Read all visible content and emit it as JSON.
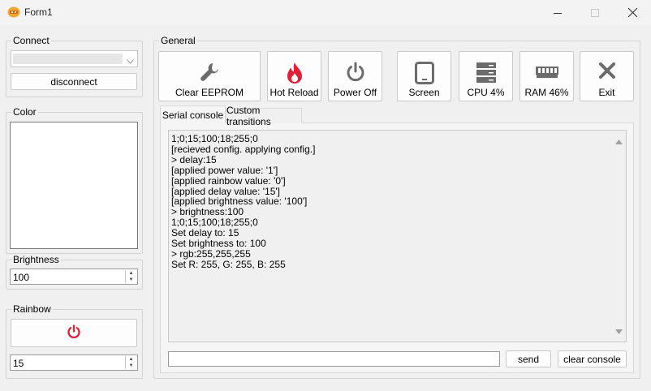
{
  "window": {
    "title": "Form1"
  },
  "connect": {
    "title": "Connect",
    "port_value": "",
    "disconnect_label": "disconnect"
  },
  "color": {
    "title": "Color"
  },
  "brightness": {
    "title": "Brightness",
    "value": "100"
  },
  "rainbow": {
    "title": "Rainbow",
    "delay_value": "15"
  },
  "general": {
    "title": "General",
    "buttons": [
      {
        "label": "Clear EEPROM",
        "icon": "wrench-icon"
      },
      {
        "label": "Hot Reload",
        "icon": "flame-icon"
      },
      {
        "label": "Power Off",
        "icon": "power-icon"
      },
      {
        "label": "Screen",
        "icon": "tablet-icon"
      },
      {
        "label": "CPU 4%",
        "icon": "server-icon"
      },
      {
        "label": "RAM 46%",
        "icon": "memory-icon"
      },
      {
        "label": "Exit",
        "icon": "close-icon"
      }
    ]
  },
  "tabs": [
    {
      "label": "Serial console",
      "active": true
    },
    {
      "label": "Custom transitions",
      "active": false
    }
  ],
  "console": {
    "lines": [
      "1;0;15;100;18;255;0",
      "[recieved config. applying config.]",
      "> delay:15",
      "[applied power value: '1']",
      "[applied rainbow value: '0']",
      "[applied delay value: '15']",
      "[applied brightness value: '100']",
      "> brightness:100",
      "1;0;15;100;18;255;0",
      "Set delay to: 15",
      "Set brightness to: 100",
      "> rgb:255,255,255",
      "Set R: 255, G: 255, B: 255"
    ],
    "input_value": "",
    "send_label": "send",
    "clear_label": "clear console"
  },
  "colors": {
    "accent_red": "#e0203a",
    "icon_gray": "#6b6b6b"
  }
}
